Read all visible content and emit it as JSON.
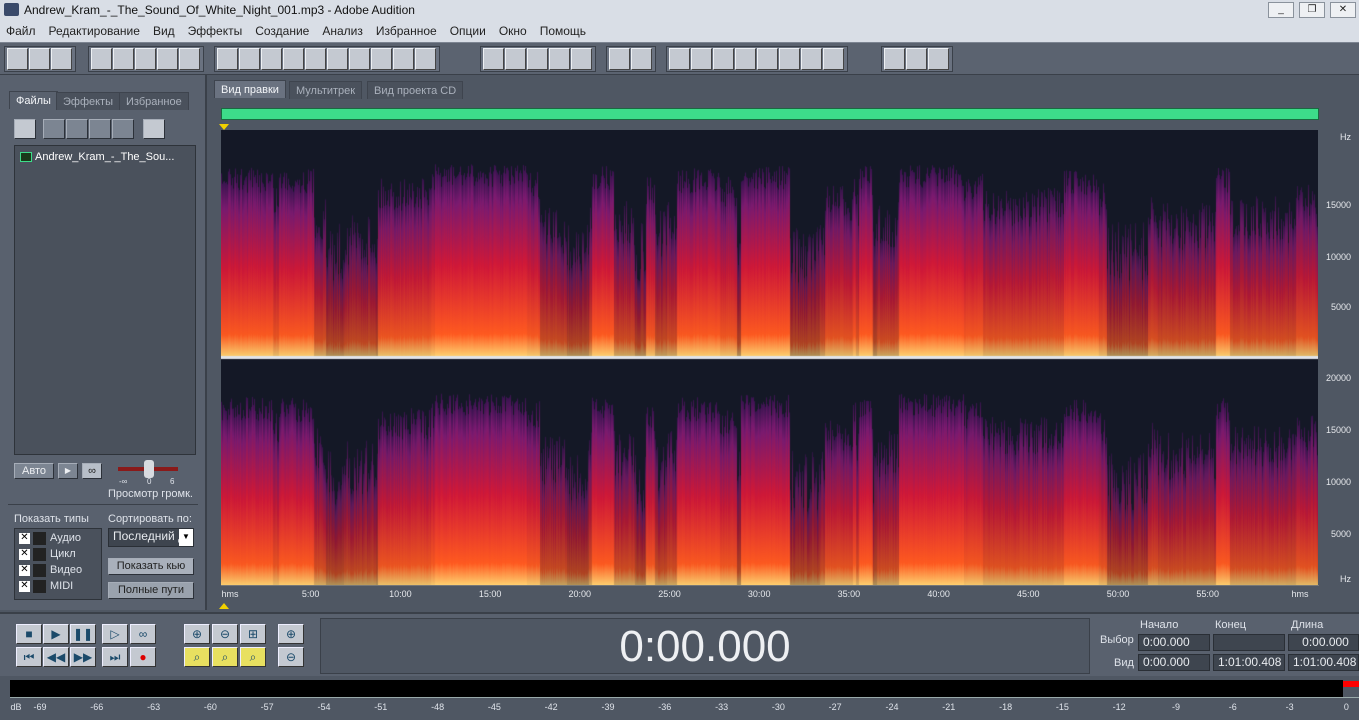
{
  "window": {
    "title": "Andrew_Kram_-_The_Sound_Of_White_Night_001.mp3 - Adobe Audition",
    "min": "_",
    "max": "❐",
    "close": "✕"
  },
  "menu": [
    "Файл",
    "Редактирование",
    "Вид",
    "Эффекты",
    "Создание",
    "Анализ",
    "Избранное",
    "Опции",
    "Окно",
    "Помощь"
  ],
  "left_panel": {
    "tabs": [
      "Файлы",
      "Эффекты",
      "Избранное"
    ],
    "files": [
      "Andrew_Kram_-_The_Sou..."
    ],
    "auto_label": "Авто",
    "preview_volume_label": "Просмотр громк.",
    "slider_ticks": [
      "-∞",
      "0",
      "6"
    ],
    "show_types_label": "Показать типы",
    "types": [
      {
        "label": "Аудио",
        "checked": true
      },
      {
        "label": "Цикл",
        "checked": true
      },
      {
        "label": "Видео",
        "checked": true
      },
      {
        "label": "MIDI",
        "checked": true
      }
    ],
    "sort_label": "Сортировать по:",
    "sort_value": "Последний д",
    "show_cue_label": "Показать кью",
    "full_paths_label": "Полные пути"
  },
  "view_tabs": [
    "Вид правки",
    "Мультитрек",
    "Вид проекта CD"
  ],
  "hz_axis_top": [
    "Hz",
    "15000",
    "10000",
    "5000"
  ],
  "hz_axis_bottom": [
    "20000",
    "15000",
    "10000",
    "5000",
    "Hz"
  ],
  "time_axis": [
    "hms",
    "5:00",
    "10:00",
    "15:00",
    "20:00",
    "25:00",
    "30:00",
    "35:00",
    "40:00",
    "45:00",
    "50:00",
    "55:00",
    "hms"
  ],
  "time_display": "0:00.000",
  "selection": {
    "headers": [
      "Начало",
      "Конец",
      "Длина"
    ],
    "row_labels": [
      "Выбор",
      "Вид"
    ],
    "sel": [
      "0:00.000",
      "",
      "0:00.000"
    ],
    "view": [
      "0:00.000",
      "1:01:00.408",
      "1:01:00.408"
    ]
  },
  "meter_scale": [
    "dB",
    "-69",
    "-66",
    "-63",
    "-60",
    "-57",
    "-54",
    "-51",
    "-48",
    "-45",
    "-42",
    "-39",
    "-36",
    "-33",
    "-30",
    "-27",
    "-24",
    "-21",
    "-18",
    "-15",
    "-12",
    "-9",
    "-6",
    "-3",
    "0"
  ],
  "colors": {
    "overview": "#3ddc8a",
    "clip": "#ff0000"
  }
}
